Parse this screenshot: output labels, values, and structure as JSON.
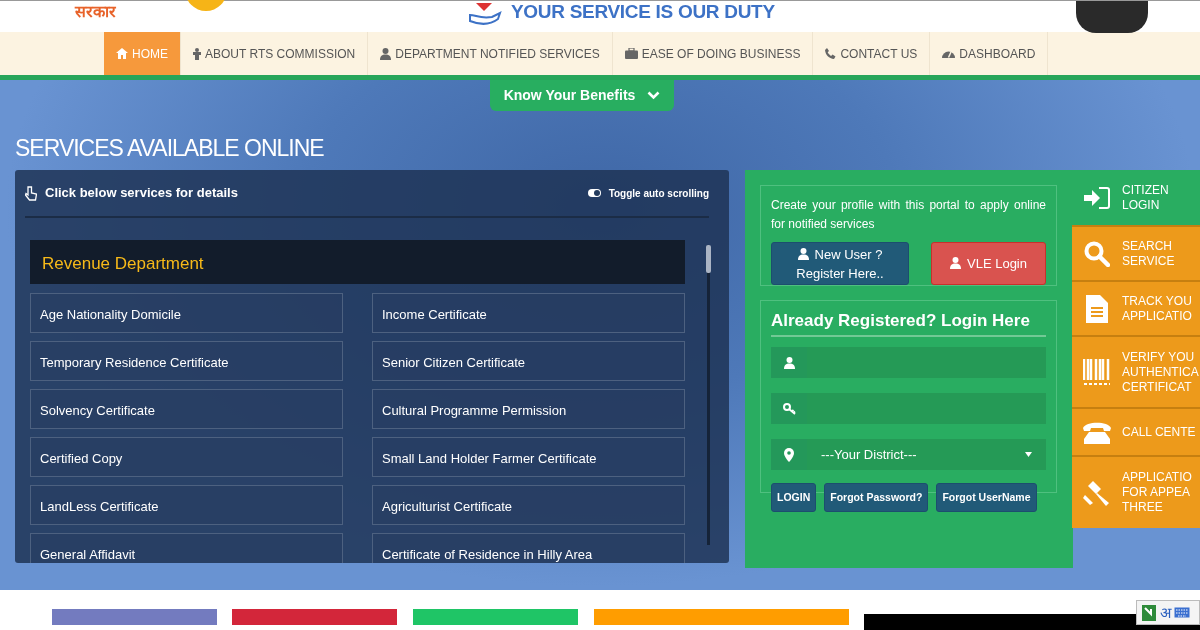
{
  "header": {
    "emblem_text": "सरकार",
    "tagline": "YOUR SERVICE IS OUR DUTY"
  },
  "nav": [
    {
      "label": "HOME",
      "selected": true
    },
    {
      "label": "ABOUT RTS COMMISSION",
      "selected": false
    },
    {
      "label": "DEPARTMENT NOTIFIED SERVICES",
      "selected": false
    },
    {
      "label": "EASE OF DOING BUSINESS",
      "selected": false
    },
    {
      "label": "CONTACT US",
      "selected": false
    },
    {
      "label": "DASHBOARD",
      "selected": false
    }
  ],
  "benefits_button": {
    "label": "Know Your Benefits"
  },
  "section_title": "SERVICES AVAILABLE ONLINE",
  "services_panel": {
    "hint": "Click below services for details",
    "toggle": {
      "label": "Toggle auto scrolling",
      "on": true
    },
    "department": "Revenue Department",
    "services": [
      "Age Nationality Domicile",
      "Income Certificate",
      "Temporary Residence Certificate",
      "Senior Citizen Certificate",
      "Solvency Certificate",
      "Cultural Programme Permission",
      "Certified Copy",
      "Small Land Holder Farmer Certificate",
      "LandLess Certificate",
      "Agriculturist Certificate",
      "General Affidavit",
      "Certificate of Residence in Hilly Area"
    ]
  },
  "register_box": {
    "text": "Create your profile with this portal to apply online for notified services",
    "buttons": [
      {
        "kind": "register",
        "lines": [
          "New User ?",
          "Register Here.."
        ]
      },
      {
        "kind": "vle",
        "lines": [
          "VLE Login"
        ]
      }
    ]
  },
  "login": {
    "title": "Already Registered? Login Here",
    "fields": [
      {
        "kind": "text"
      },
      {
        "kind": "password"
      },
      {
        "kind": "select",
        "value": "---Your District---"
      }
    ],
    "buttons": [
      "LOGIN",
      "Forgot Password?",
      "Forgot UserName"
    ]
  },
  "side_menu": [
    {
      "kind": "header",
      "lines": [
        "CITIZEN",
        "LOGIN"
      ]
    },
    {
      "kind": "item",
      "lines": [
        "SEARCH",
        "SERVICE"
      ]
    },
    {
      "kind": "item",
      "lines": [
        "TRACK YOU",
        "APPLICATIO"
      ]
    },
    {
      "kind": "item",
      "lines": [
        "VERIFY YOU",
        "AUTHENTICA",
        "CERTIFICAT"
      ]
    },
    {
      "kind": "item",
      "lines": [
        "CALL CENTE"
      ]
    },
    {
      "kind": "item",
      "lines": [
        "APPLICATIO",
        "FOR APPEA",
        "THREE"
      ]
    }
  ],
  "bottom_tiles": [
    {
      "color": "#737bbf"
    },
    {
      "color": "#d3263a"
    },
    {
      "color": "#1fc566"
    },
    {
      "color": "#ff9d00"
    },
    {
      "color": "#000000"
    }
  ],
  "ime_toolbar": {
    "label": "अ"
  }
}
